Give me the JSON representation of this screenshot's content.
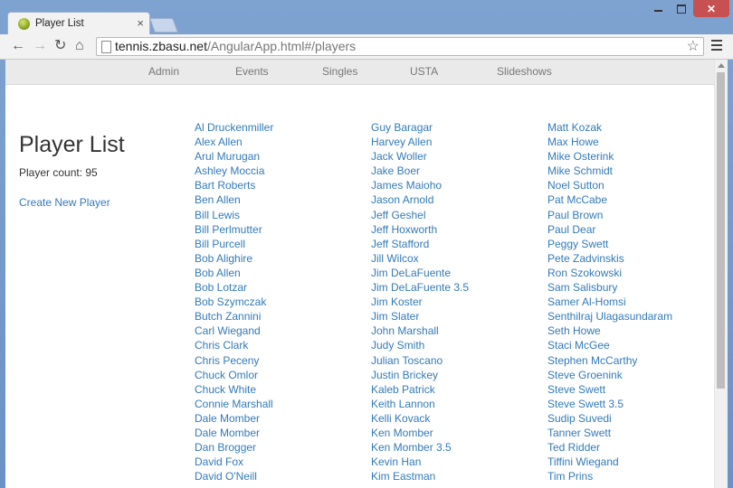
{
  "browser": {
    "tab_title": "Player List",
    "tab_close": "×",
    "url_host": "tennis.zbasu.net",
    "url_path": "/AngularApp.html#/players"
  },
  "navbar": {
    "links": [
      "Admin",
      "Events",
      "Singles",
      "USTA",
      "Slideshows"
    ]
  },
  "page": {
    "title": "Player List",
    "count_label": "Player count: 95",
    "create_link": "Create New Player"
  },
  "players": {
    "column1": [
      "Al Druckenmiller",
      "Alex Allen",
      "Arul Murugan",
      "Ashley Moccia",
      "Bart Roberts",
      "Ben Allen",
      "Bill Lewis",
      "Bill Perlmutter",
      "Bill Purcell",
      "Bob Alighire",
      "Bob Allen",
      "Bob Lotzar",
      "Bob Szymczak",
      "Butch Zannini",
      "Carl Wiegand",
      "Chris Clark",
      "Chris Peceny",
      "Chuck Omlor",
      "Chuck White",
      "Connie Marshall",
      "Dale Momber",
      "Dale Momber",
      "Dan Brogger",
      "David Fox",
      "David O'Neill"
    ],
    "column2": [
      "Guy Baragar",
      "Harvey Allen",
      "Jack Woller",
      "Jake Boer",
      "James Maioho",
      "Jason Arnold",
      "Jeff Geshel",
      "Jeff Hoxworth",
      "Jeff Stafford",
      "Jill Wilcox",
      "Jim DeLaFuente",
      "Jim DeLaFuente 3.5",
      "Jim Koster",
      "Jim Slater",
      "John Marshall",
      "Judy Smith",
      "Julian Toscano",
      "Justin Brickey",
      "Kaleb Patrick",
      "Keith Lannon",
      "Kelli Kovack",
      "Ken Momber",
      "Ken Momber 3.5",
      "Kevin Han",
      "Kim Eastman"
    ],
    "column3": [
      "Matt Kozak",
      "Max Howe",
      "Mike Osterink",
      "Mike Schmidt",
      "Noel Sutton",
      "Pat McCabe",
      "Paul Brown",
      "Paul Dear",
      "Peggy Swett",
      "Pete Zadvinskis",
      "Ron Szokowski",
      "Sam Salisbury",
      "Samer Al-Homsi",
      "Senthilraj Ulagasundaram",
      "Seth Howe",
      "Staci McGee",
      "Stephen McCarthy",
      "Steve Groenink",
      "Steve Swett",
      "Steve Swett 3.5",
      "Sudip Suvedi",
      "Tanner Swett",
      "Ted Ridder",
      "Tiffini Wiegand",
      "Tim Prins"
    ]
  }
}
